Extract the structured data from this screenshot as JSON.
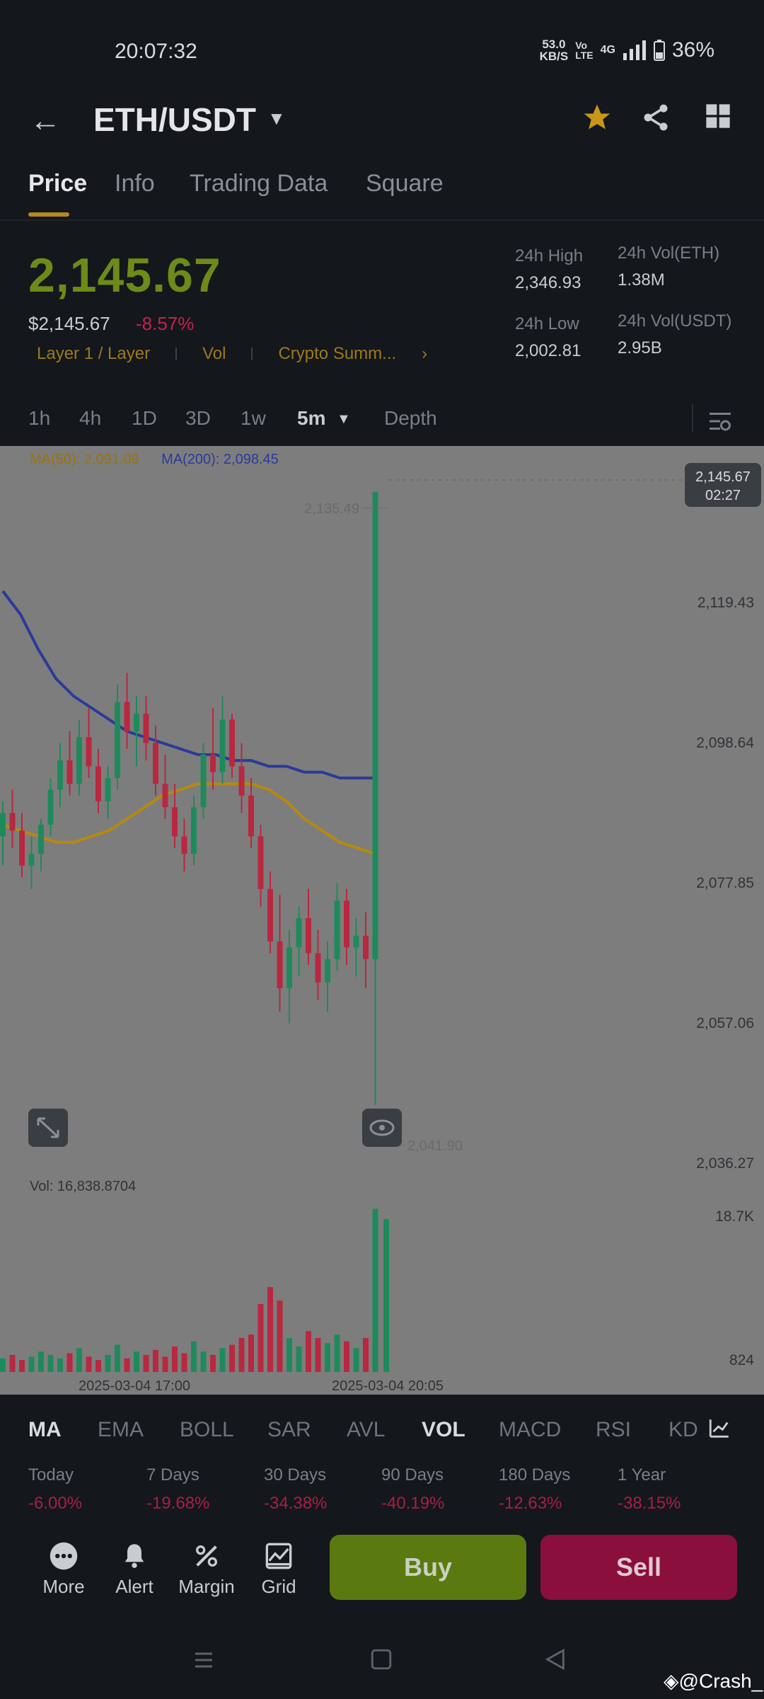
{
  "status": {
    "time": "20:07:32",
    "speed_value": "53.0",
    "speed_unit": "KB/S",
    "volte_top": "Vo",
    "volte_bottom": "LTE",
    "net": "4G",
    "battery": "36%"
  },
  "header": {
    "pair": "ETH/USDT"
  },
  "tabs": [
    "Price",
    "Info",
    "Trading Data",
    "Square"
  ],
  "price": {
    "last": "2,145.67",
    "usd": "$2,145.67",
    "change": "-8.57%"
  },
  "tags": [
    "Layer 1 / Layer",
    "Vol",
    "Crypto Summ..."
  ],
  "stats": {
    "high_label": "24h High",
    "high": "2,346.93",
    "low_label": "24h Low",
    "low": "2,002.81",
    "vol_eth_label": "24h Vol(ETH)",
    "vol_eth": "1.38M",
    "vol_usdt_label": "24h Vol(USDT)",
    "vol_usdt": "2.95B"
  },
  "timeframes": [
    "1h",
    "4h",
    "1D",
    "3D",
    "1w",
    "5m",
    "Depth"
  ],
  "legend": {
    "ma50": "MA(50): 2,091.09",
    "ma200": "MA(200): 2,098.45",
    "vol": "Vol: 16,838.8704"
  },
  "chart_data": {
    "type": "candlestick",
    "price_axis": [
      "2,119.43",
      "2,098.64",
      "2,077.85",
      "2,057.06",
      "2,036.27"
    ],
    "ylim": [
      2030,
      2150
    ],
    "current": {
      "price": "2,145.67",
      "countdown": "02:27"
    },
    "high_marker": "2,135.49",
    "low_marker": "2,041.90",
    "volume_axis": [
      "18.7K",
      "824"
    ],
    "time_labels": [
      "2025-03-04 17:00",
      "2025-03-04 20:05"
    ],
    "colors": {
      "up": "#1e8a5c",
      "down": "#b8283f",
      "ma50": "#b58a10",
      "ma200": "#2b3a9a"
    },
    "series_note": "",
    "candles": [
      [
        2088,
        2094,
        2083,
        2092
      ],
      [
        2092,
        2096,
        2086,
        2089
      ],
      [
        2089,
        2092,
        2081,
        2083
      ],
      [
        2083,
        2088,
        2079,
        2085
      ],
      [
        2085,
        2091,
        2082,
        2090
      ],
      [
        2090,
        2098,
        2088,
        2096
      ],
      [
        2096,
        2104,
        2093,
        2101
      ],
      [
        2101,
        2106,
        2095,
        2097
      ],
      [
        2097,
        2108,
        2095,
        2105
      ],
      [
        2105,
        2110,
        2098,
        2100
      ],
      [
        2100,
        2103,
        2092,
        2094
      ],
      [
        2094,
        2100,
        2091,
        2098
      ],
      [
        2098,
        2114,
        2096,
        2111
      ],
      [
        2111,
        2116,
        2103,
        2106
      ],
      [
        2106,
        2112,
        2100,
        2109
      ],
      [
        2109,
        2112,
        2101,
        2104
      ],
      [
        2104,
        2107,
        2095,
        2097
      ],
      [
        2097,
        2102,
        2091,
        2093
      ],
      [
        2093,
        2097,
        2086,
        2088
      ],
      [
        2088,
        2091,
        2082,
        2085
      ],
      [
        2085,
        2095,
        2083,
        2093
      ],
      [
        2093,
        2104,
        2091,
        2102
      ],
      [
        2102,
        2110,
        2096,
        2099
      ],
      [
        2099,
        2112,
        2097,
        2108
      ],
      [
        2108,
        2109,
        2098,
        2100
      ],
      [
        2100,
        2104,
        2092,
        2095
      ],
      [
        2095,
        2098,
        2086,
        2088
      ],
      [
        2088,
        2090,
        2076,
        2079
      ],
      [
        2079,
        2082,
        2068,
        2070
      ],
      [
        2070,
        2078,
        2058,
        2062
      ],
      [
        2062,
        2072,
        2056,
        2069
      ],
      [
        2069,
        2076,
        2064,
        2074
      ],
      [
        2074,
        2079,
        2066,
        2068
      ],
      [
        2068,
        2072,
        2060,
        2063
      ],
      [
        2063,
        2070,
        2058,
        2067
      ],
      [
        2067,
        2080,
        2065,
        2077
      ],
      [
        2077,
        2079,
        2066,
        2069
      ],
      [
        2069,
        2074,
        2064,
        2071
      ],
      [
        2071,
        2075,
        2062,
        2067
      ],
      [
        2067,
        2072,
        2042,
        2147
      ]
    ],
    "ma50_line": [
      2090,
      2089,
      2088,
      2087,
      2087,
      2088,
      2089,
      2091,
      2093,
      2095,
      2096,
      2097,
      2097,
      2097,
      2097,
      2096,
      2094,
      2091,
      2089,
      2087,
      2086,
      2085
    ],
    "ma200_line": [
      2130,
      2126,
      2120,
      2115,
      2112,
      2110,
      2108,
      2106,
      2105,
      2104,
      2103,
      2102,
      2102,
      2101,
      2101,
      2100,
      2100,
      2099,
      2099,
      2098,
      2098,
      2098
    ],
    "volumes": [
      0.08,
      0.1,
      0.07,
      0.09,
      0.12,
      0.1,
      0.08,
      0.11,
      0.14,
      0.09,
      0.07,
      0.1,
      0.16,
      0.08,
      0.12,
      0.1,
      0.13,
      0.09,
      0.15,
      0.11,
      0.18,
      0.12,
      0.1,
      0.14,
      0.16,
      0.2,
      0.22,
      0.4,
      0.5,
      0.42,
      0.2,
      0.15,
      0.24,
      0.2,
      0.17,
      0.22,
      0.18,
      0.14,
      0.2,
      0.96
    ]
  },
  "indicators": [
    "MA",
    "EMA",
    "BOLL",
    "SAR",
    "AVL",
    "VOL",
    "MACD",
    "RSI",
    "KD"
  ],
  "performance": [
    {
      "label": "Today",
      "value": "-6.00%"
    },
    {
      "label": "7 Days",
      "value": "-19.68%"
    },
    {
      "label": "30 Days",
      "value": "-34.38%"
    },
    {
      "label": "90 Days",
      "value": "-40.19%"
    },
    {
      "label": "180 Days",
      "value": "-12.63%"
    },
    {
      "label": "1 Year",
      "value": "-38.15%"
    }
  ],
  "actions": [
    "More",
    "Alert",
    "Margin",
    "Grid"
  ],
  "buy": "Buy",
  "sell": "Sell",
  "watermark": "@Crash_"
}
